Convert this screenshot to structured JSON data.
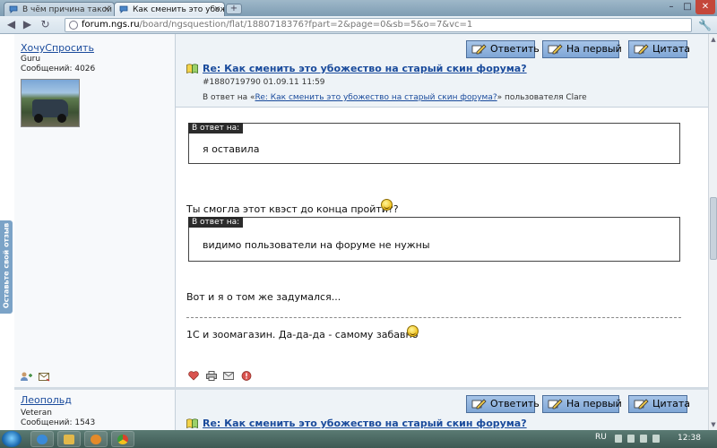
{
  "browser": {
    "tabs": [
      {
        "label": "В чём причина такой бес..."
      },
      {
        "label": "Как сменить это убожеств..."
      }
    ],
    "new_tab": "+",
    "window_controls": {
      "minimize": "–",
      "maximize": "□",
      "close": "✕"
    },
    "url_host": "forum.ngs.ru",
    "url_path": "/board/ngsquestion/flat/1880718376?fpart=2&page=0&sb=5&o=7&vc=1"
  },
  "feedback_tab": "Оставьте свой отзыв",
  "post1": {
    "user": {
      "name": "ХочуСпросить",
      "rank": "Guru",
      "messages": "Сообщений: 4026"
    },
    "buttons": {
      "reply": "Ответить",
      "first": "На первый",
      "quote": "Цитата"
    },
    "title": "Re: Как сменить это убожество на старый скин форума?",
    "meta": "#1880719790 01.09.11 11:59",
    "reply_prefix": "В ответ на «",
    "reply_link": "Re: Как сменить это убожество на старый скин форума?",
    "reply_suffix": "» пользователя Clare",
    "quote_label": "В ответ на:",
    "quote1": "я оставила",
    "text1": "Ты смогла этот квэст до конца пройти??",
    "quote2": "видимо пользователи на форуме не нужны",
    "text2": "Вот и я о том же задумался...",
    "text3": "1С и зоомагазин. Да-да-да - самому забавно"
  },
  "post2": {
    "user": {
      "name": "Леопольд",
      "rank": "Veteran",
      "messages": "Сообщений: 1543"
    },
    "buttons": {
      "reply": "Ответить",
      "first": "На первый",
      "quote": "Цитата"
    },
    "title": "Re: Как сменить это убожество на старый скин форума?"
  },
  "taskbar": {
    "lang": "RU",
    "time": "12:38"
  },
  "colors": {
    "link": "#1a4b9c",
    "button": "#8fb1de",
    "button_border": "#4d6f9b",
    "quote_label_bg": "#2b2b2b"
  }
}
